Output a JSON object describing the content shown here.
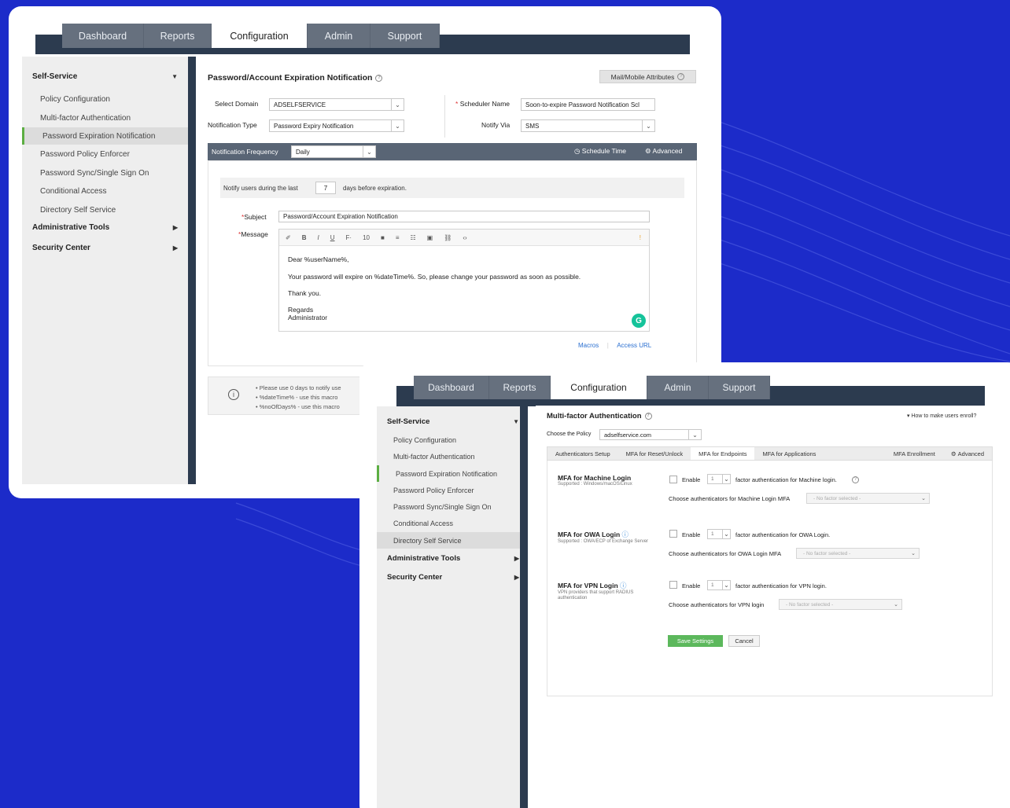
{
  "screen1": {
    "nav_tabs": [
      "Dashboard",
      "Reports",
      "Configuration",
      "Admin",
      "Support"
    ],
    "active_tab": "Configuration",
    "sidebar": {
      "section_self_service": "Self-Service",
      "items": [
        "Policy Configuration",
        "Multi-factor Authentication",
        "Password Expiration Notification",
        "Password Policy Enforcer",
        "Password Sync/Single Sign On",
        "Conditional Access",
        "Directory Self Service"
      ],
      "active_item": "Password Expiration Notification",
      "section_admin_tools": "Administrative Tools",
      "section_security": "Security Center"
    },
    "panel": {
      "title": "Password/Account Expiration Notification",
      "mail_mobile_button": "Mail/Mobile Attributes",
      "select_domain_label": "Select Domain",
      "select_domain_value": "ADSELFSERVICE",
      "notification_type_label": "Notification Type",
      "notification_type_value": "Password Expiry Notification",
      "scheduler_name_label": "Scheduler Name",
      "scheduler_name_value": "Soon-to-expire Password Notification Scl",
      "notify_via_label": "Notify Via",
      "notify_via_value": "SMS",
      "frequency_label": "Notification Frequency",
      "frequency_value": "Daily",
      "schedule_time": "Schedule Time",
      "advanced": "Advanced",
      "notify_prefix": "Notify users during the last",
      "notify_days": "7",
      "notify_suffix": "days before expiration.",
      "subject_label": "Subject",
      "subject_value": "Password/Account Expiration Notification",
      "message_label": "Message",
      "font_size": "10",
      "message_lines": [
        "Dear %userName%,",
        "Your password will expire on %dateTime%. So, please change your password as soon as possible.",
        "Thank you.",
        "Regards",
        "Administrator"
      ],
      "macros_link": "Macros",
      "access_url_link": "Access URL",
      "notes": [
        "Please use 0 days to notify use",
        "%dateTime% - use this macro",
        "%noOfDays% - use this macro"
      ]
    }
  },
  "screen2": {
    "nav_tabs": [
      "Dashboard",
      "Reports",
      "Configuration",
      "Admin",
      "Support"
    ],
    "active_tab": "Configuration",
    "sidebar": {
      "section_self_service": "Self-Service",
      "items": [
        "Policy Configuration",
        "Multi-factor Authentication",
        "Password Expiration Notification",
        "Password Policy Enforcer",
        "Password Sync/Single Sign On",
        "Conditional Access",
        "Directory Self Service"
      ],
      "active_item": "Directory Self Service",
      "section_admin_tools": "Administrative Tools",
      "section_security": "Security Center"
    },
    "panel": {
      "title": "Multi-factor Authentication",
      "enroll_link": "How to make users enroll?",
      "policy_label": "Choose the Policy",
      "policy_value": "adselfservice.com",
      "subtabs": [
        "Authenticators Setup",
        "MFA for Reset/Unlock",
        "MFA for Endpoints",
        "MFA for Applications"
      ],
      "active_subtab": "MFA for Endpoints",
      "mfa_enrollment": "MFA Enrollment",
      "advanced": "Advanced",
      "enable_label": "Enable",
      "factor_count": "1",
      "sections": [
        {
          "title": "MFA for Machine Login",
          "sub": "Supported : Windows/macOS/Linux",
          "factor_text": "factor authentication for Machine login.",
          "choose_label": "Choose authenticators for Machine Login MFA",
          "placeholder": "- No factor selected -"
        },
        {
          "title": "MFA for OWA Login",
          "sub": "Supported : OWA/ECP of Exchange Server",
          "factor_text": "factor authentication for OWA Login.",
          "choose_label": "Choose authenticators for OWA Login MFA",
          "placeholder": "- No factor selected -"
        },
        {
          "title": "MFA for VPN Login",
          "sub": "VPN providers that support RADIUS authentication",
          "factor_text": "factor authentication for VPN login.",
          "choose_label": "Choose authenticators for VPN login",
          "placeholder": "- No factor selected -"
        }
      ],
      "save_button": "Save Settings",
      "cancel_button": "Cancel"
    }
  },
  "colors": {
    "background": "#1c2bc9",
    "dark_bar": "#2c3b4f",
    "tab_bar": "#66707e",
    "accent_green": "#5cb85c",
    "link_blue": "#2a6fd0"
  }
}
